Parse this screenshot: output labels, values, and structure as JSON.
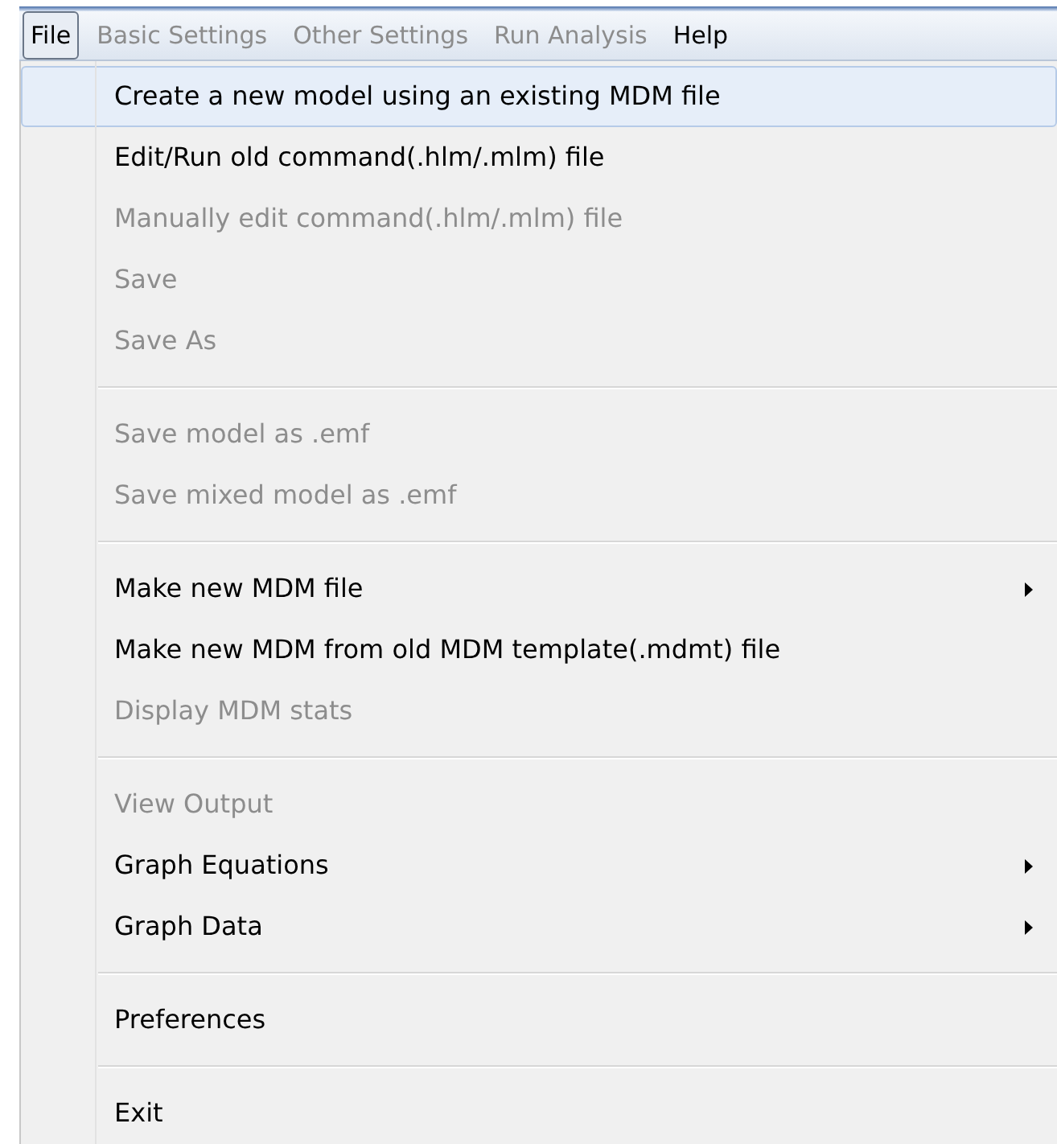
{
  "menubar": [
    {
      "label": "File",
      "selected": true,
      "disabled": false
    },
    {
      "label": "Basic Settings",
      "selected": false,
      "disabled": true
    },
    {
      "label": "Other Settings",
      "selected": false,
      "disabled": true
    },
    {
      "label": "Run Analysis",
      "selected": false,
      "disabled": true
    },
    {
      "label": "Help",
      "selected": false,
      "disabled": false
    }
  ],
  "menu": {
    "groups": [
      {
        "items": [
          {
            "label": "Create a new model using an existing MDM file",
            "selected": true,
            "disabled": false,
            "submenu": false
          },
          {
            "label": "Edit/Run old command(.hlm/.mlm) file",
            "selected": false,
            "disabled": false,
            "submenu": false
          },
          {
            "label": "Manually edit command(.hlm/.mlm) file",
            "selected": false,
            "disabled": true,
            "submenu": false
          },
          {
            "label": "Save",
            "selected": false,
            "disabled": true,
            "submenu": false
          },
          {
            "label": "Save As",
            "selected": false,
            "disabled": true,
            "submenu": false
          }
        ]
      },
      {
        "items": [
          {
            "label": "Save model as .emf",
            "selected": false,
            "disabled": true,
            "submenu": false
          },
          {
            "label": "Save mixed model as .emf",
            "selected": false,
            "disabled": true,
            "submenu": false
          }
        ]
      },
      {
        "items": [
          {
            "label": "Make new MDM file",
            "selected": false,
            "disabled": false,
            "submenu": true
          },
          {
            "label": "Make new MDM from old MDM template(.mdmt) file",
            "selected": false,
            "disabled": false,
            "submenu": false
          },
          {
            "label": "Display MDM stats",
            "selected": false,
            "disabled": true,
            "submenu": false
          }
        ]
      },
      {
        "items": [
          {
            "label": "View Output",
            "selected": false,
            "disabled": true,
            "submenu": false
          },
          {
            "label": "Graph Equations",
            "selected": false,
            "disabled": false,
            "submenu": true
          },
          {
            "label": "Graph Data",
            "selected": false,
            "disabled": false,
            "submenu": true
          }
        ]
      },
      {
        "items": [
          {
            "label": "Preferences",
            "selected": false,
            "disabled": false,
            "submenu": false
          }
        ]
      },
      {
        "items": [
          {
            "label": "Exit",
            "selected": false,
            "disabled": false,
            "submenu": false
          }
        ]
      }
    ]
  }
}
